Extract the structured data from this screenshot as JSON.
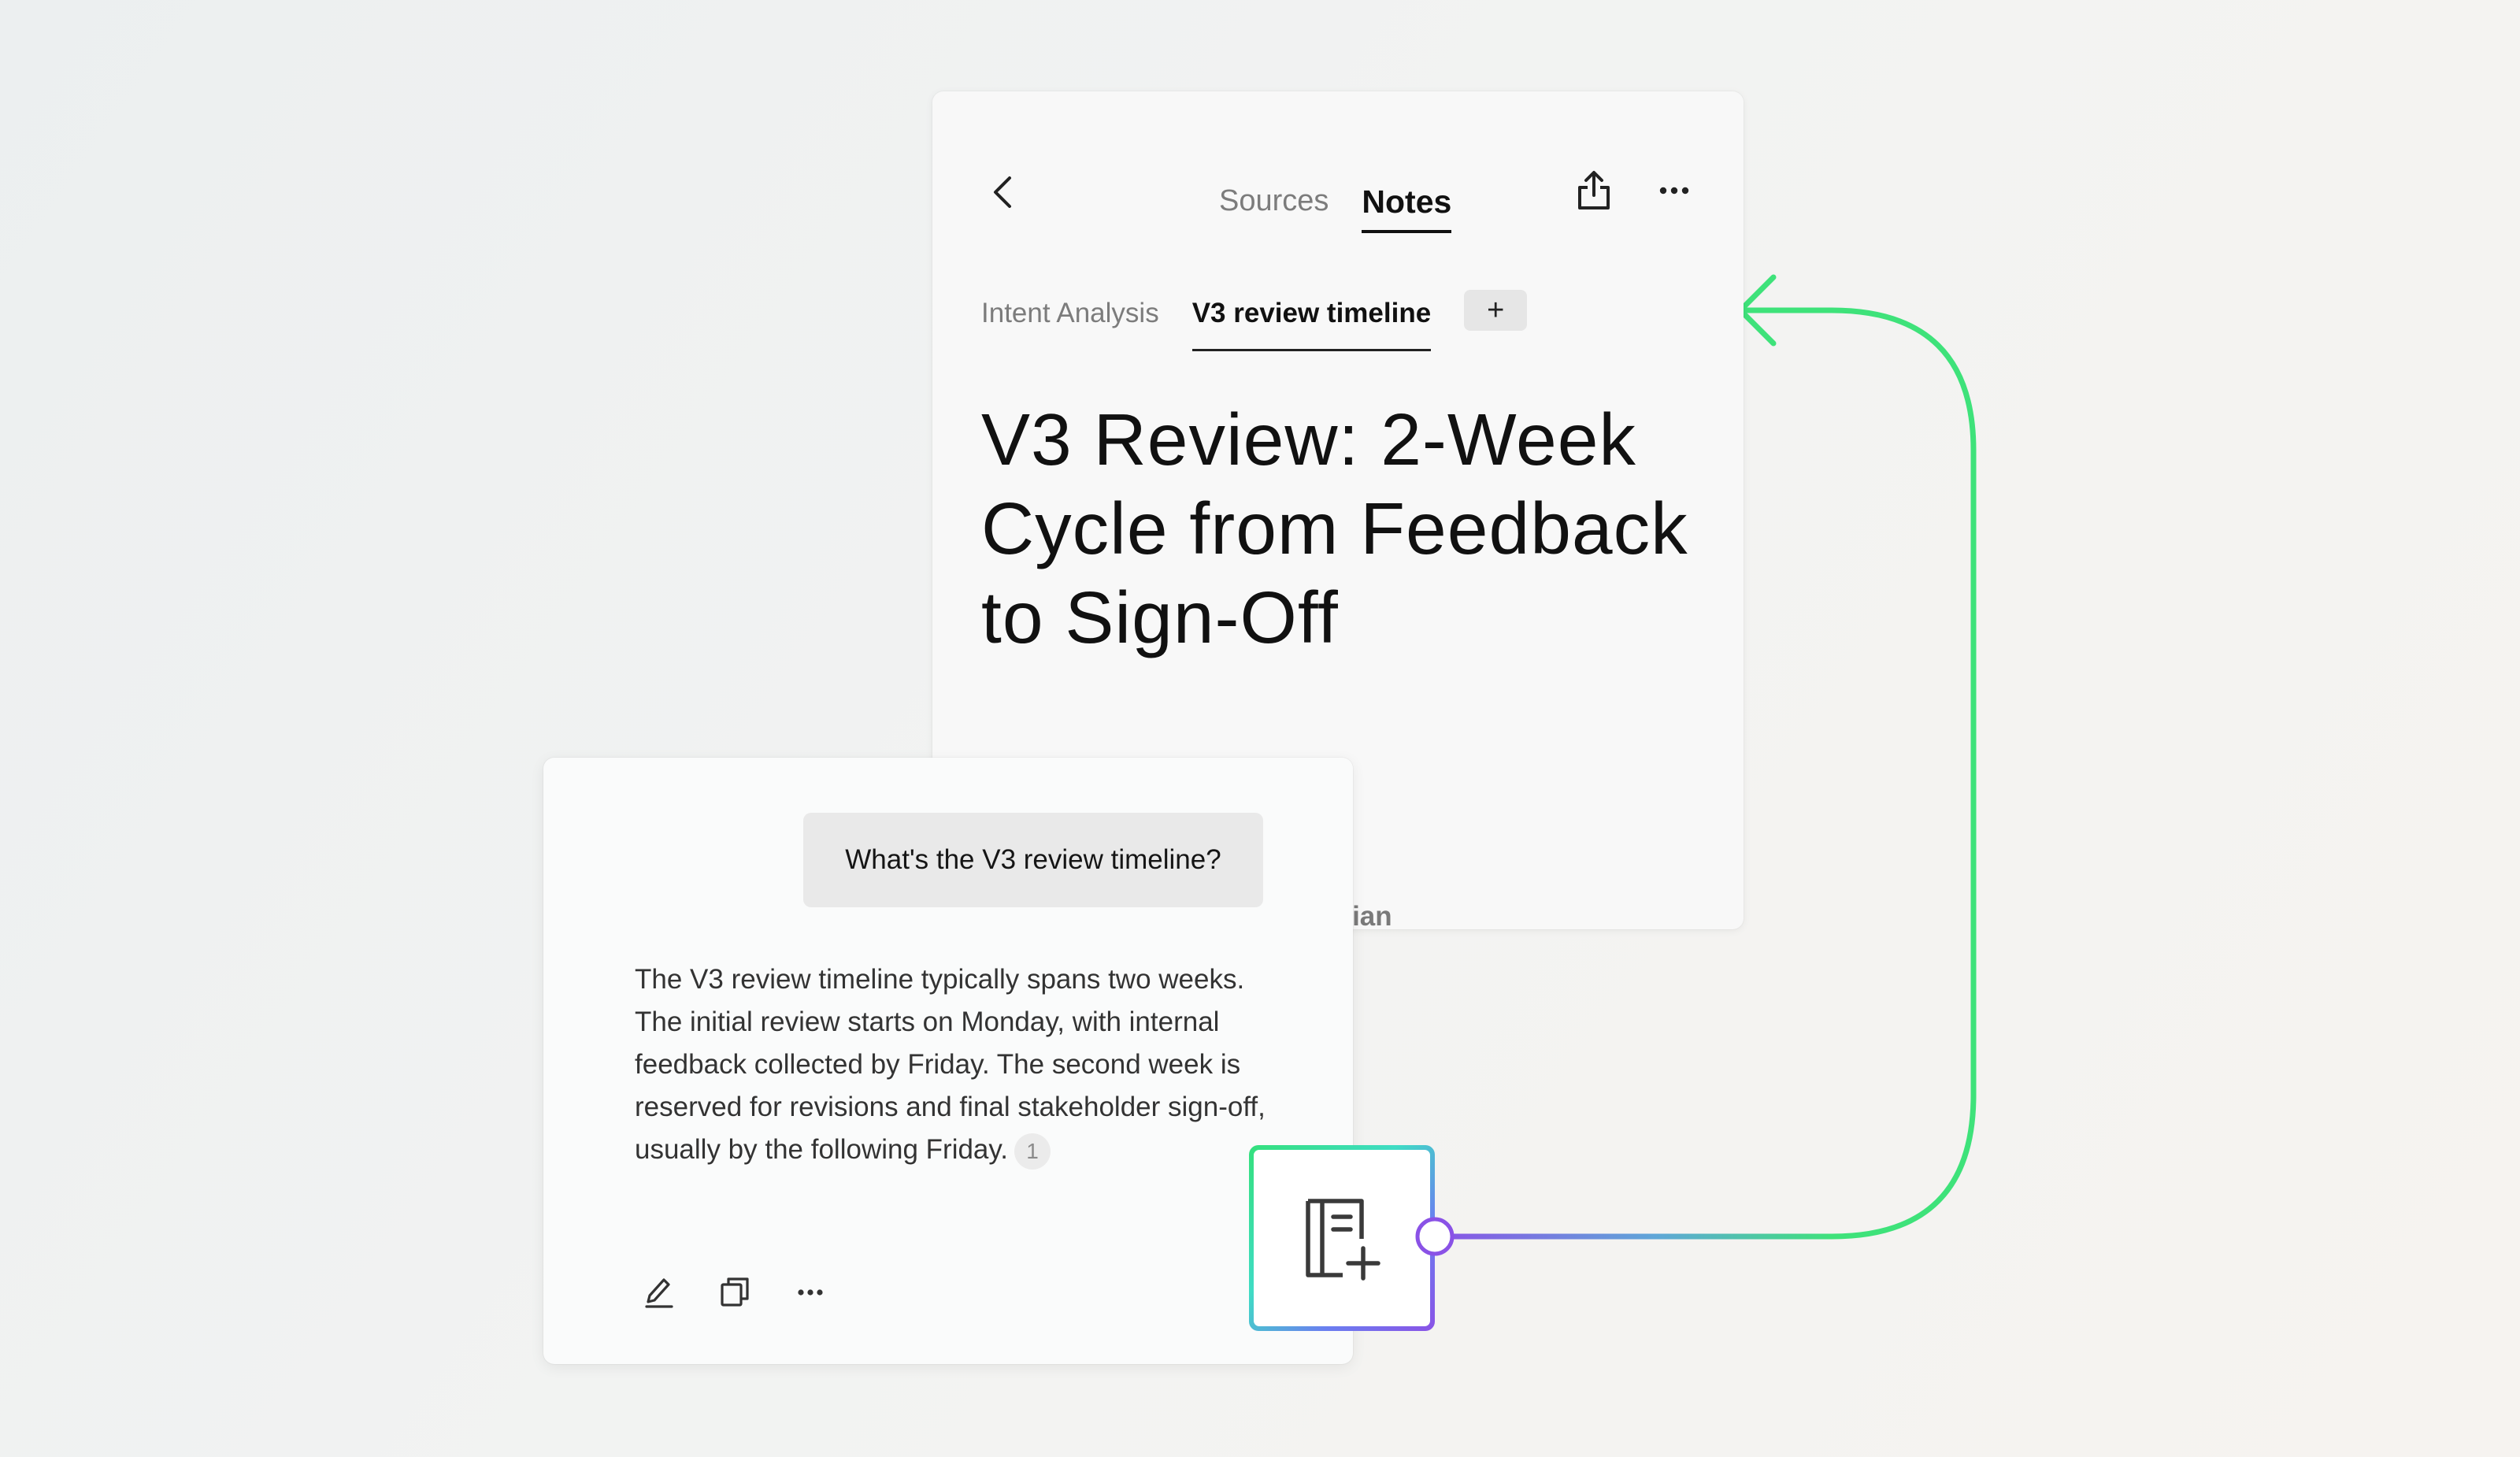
{
  "notes_panel": {
    "tabs": [
      "Sources",
      "Notes"
    ],
    "active_tab": "Notes",
    "note_tabs": [
      "Intent Analysis",
      "V3 review timeline"
    ],
    "active_note_tab": "V3 review timeline",
    "add_tab_label": "+",
    "note_title": "V3 Review: 2-Week Cycle from Feedback to Sign-Off",
    "author_fragment": "3rian"
  },
  "chat": {
    "user_message": "What's the V3 review timeline?",
    "assistant_answer": "The V3 review timeline typically spans two weeks. The initial review starts on Monday, with internal feedback collected by Friday. The second week is reserved for revisions and final stakeholder sign-off, usually by the following Friday.",
    "citation": "1"
  },
  "icons": {
    "back": "chevron-left-icon",
    "share": "share-icon",
    "more": "more-horizontal-icon",
    "edit": "pencil-icon",
    "copy": "copy-icon",
    "add_note": "note-add-icon"
  },
  "colors": {
    "connector_green": "#3ee27a",
    "connector_purple": "#8a52e6",
    "ink": "#111111",
    "muted": "#7c7c7c"
  }
}
